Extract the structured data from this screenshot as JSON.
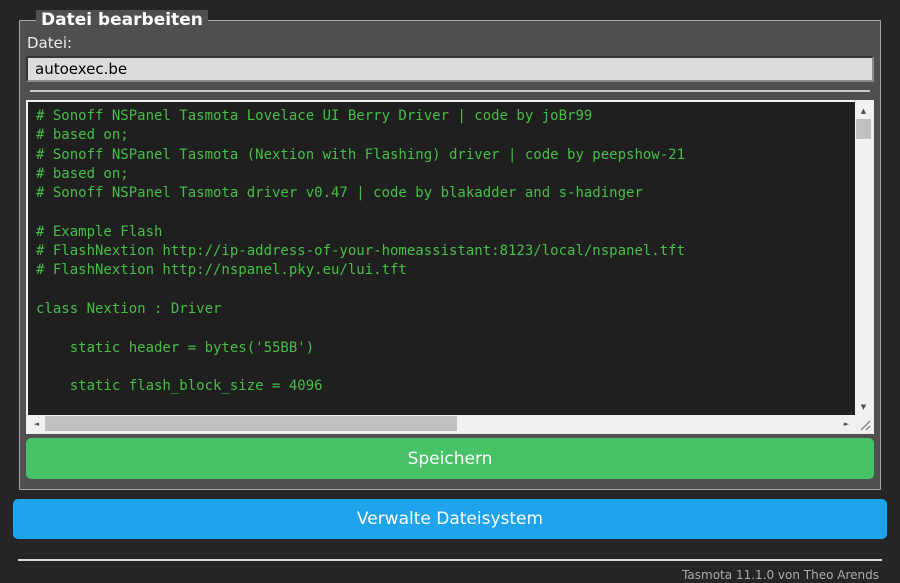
{
  "window": {
    "background": "#252525"
  },
  "colors": {
    "form_bg": "#4f4f4f",
    "page_text": "#eaeaea",
    "console_bg": "#1f1f1f",
    "console_text": "#46be46",
    "input_bg": "#dcdcdc",
    "input_text": "#000000",
    "save_green": "#47c266",
    "fs_blue": "#1fa3ec",
    "footer_text": "#aaaaaa",
    "scroll_track": "#f1f1f1",
    "scroll_thumb": "#c1c1c1",
    "scroll_arrow": "#505050"
  },
  "edit_panel": {
    "legend": "Datei bearbeiten",
    "file_label": "Datei:",
    "filename_value": "autoexec.be",
    "file_content_lines": [
      "# Sonoff NSPanel Tasmota Lovelace UI Berry Driver | code by joBr99",
      "# based on;",
      "# Sonoff NSPanel Tasmota (Nextion with Flashing) driver | code by peepshow-21",
      "# based on;",
      "# Sonoff NSPanel Tasmota driver v0.47 | code by blakadder and s-hadinger",
      "",
      "# Example Flash",
      "# FlashNextion http://ip-address-of-your-homeassistant:8123/local/nspanel.tft",
      "# FlashNextion http://nspanel.pky.eu/lui.tft",
      "",
      "class Nextion : Driver",
      "",
      "    static header = bytes('55BB')",
      "",
      "    static flash_block_size = 4096"
    ],
    "save_button_label": "Speichern"
  },
  "manage_fs_button_label": "Verwalte Dateisystem",
  "footer": {
    "credit": "Tasmota 11.1.0 von Theo Arends"
  },
  "icons": {
    "scroll_up": "▲",
    "scroll_down": "▼",
    "scroll_left": "◄",
    "scroll_right": "►"
  }
}
